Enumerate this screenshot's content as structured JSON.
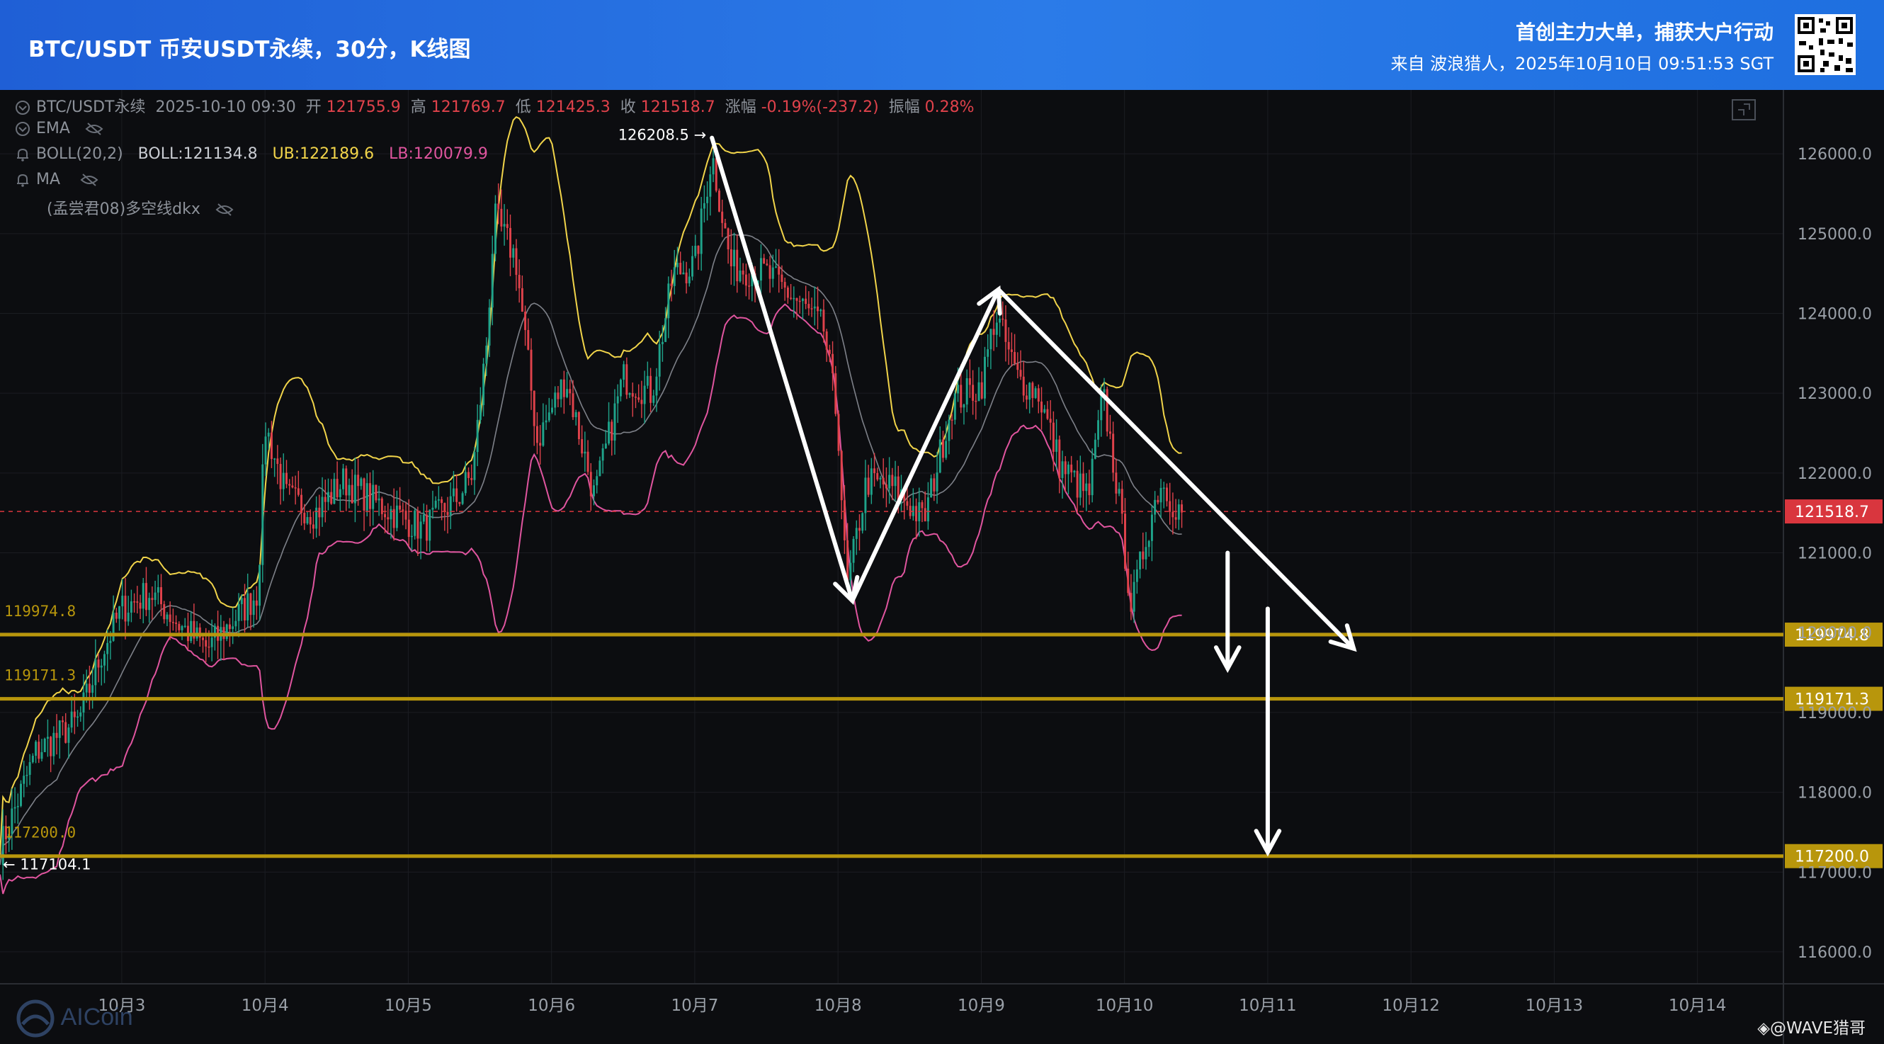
{
  "header": {
    "title": "BTC/USDT 币安USDT永续，30分，K线图",
    "tagline": "首创主力大单，捕获大户行动",
    "source": "来自 波浪猎人，2025年10月10日 09:51:53 SGT"
  },
  "legend": {
    "symbol": "BTC/USDT永续",
    "datetime": "2025-10-10 09:30",
    "open_label": "开",
    "open": "121755.9",
    "high_label": "高",
    "high": "121769.7",
    "low_label": "低",
    "low": "121425.3",
    "close_label": "收",
    "close": "121518.7",
    "change_label": "涨幅",
    "change": "-0.19%(-237.2)",
    "amplitude_label": "振幅",
    "amplitude": "0.28%",
    "ema": "EMA",
    "boll": "BOLL(20,2)",
    "boll_mid": "BOLL:121134.8",
    "boll_ub": "UB:122189.6",
    "boll_lb": "LB:120079.9",
    "ma": "MA",
    "custom": "(孟尝君08)多空线dkx"
  },
  "watermark": {
    "brand": "AICoin",
    "author": "◈@WAVE猎哥"
  },
  "colors": {
    "up": "#1fa38a",
    "down": "#e0424b",
    "ub": "#f1d44a",
    "lb": "#e0559f",
    "mid": "#9a9ea6",
    "level": "#b8960c",
    "price_tag": "#d9363e",
    "arrow": "#ffffff"
  },
  "chart_data": {
    "type": "candlestick",
    "interval": "30m",
    "ylim": [
      115600,
      126800
    ],
    "yticks": [
      116000,
      117000,
      118000,
      119000,
      120000,
      121000,
      122000,
      123000,
      124000,
      125000,
      126000
    ],
    "ytick_labels": [
      "116000.0",
      "117000.0",
      "118000.0",
      "119000.0",
      "120000.0",
      "121000.0",
      "122000.0",
      "123000.0",
      "124000.0",
      "125000.0",
      "126000.0"
    ],
    "x_day_labels": [
      "10月3",
      "10月4",
      "10月5",
      "10月6",
      "10月7",
      "10月8",
      "10月9",
      "10月10",
      "10月11",
      "10月12",
      "10月13",
      "10月14"
    ],
    "x_day_positions": [
      3,
      4,
      5,
      6,
      7,
      8,
      9,
      10,
      11,
      12,
      13,
      14
    ],
    "xlim": [
      2.15,
      14.6
    ],
    "current_price": 121518.7,
    "current_price_label": "121518.7",
    "max_annotation": {
      "x": 7.12,
      "y": 126208.5,
      "label": "126208.5 →"
    },
    "min_annotation": {
      "x": 2.15,
      "y": 117104.1,
      "label": "← 117104.1"
    },
    "levels": [
      {
        "value": 119974.8,
        "label": "119974.8"
      },
      {
        "value": 119171.3,
        "label": "119171.3"
      },
      {
        "value": 117200.0,
        "label": "117200.0"
      }
    ],
    "close_path": [
      [
        2.15,
        117300
      ],
      [
        2.4,
        118500
      ],
      [
        2.7,
        118900
      ],
      [
        2.85,
        119700
      ],
      [
        3.0,
        120300
      ],
      [
        3.2,
        120500
      ],
      [
        3.4,
        120100
      ],
      [
        3.6,
        119800
      ],
      [
        3.8,
        120200
      ],
      [
        3.95,
        120500
      ],
      [
        4.0,
        122600
      ],
      [
        4.15,
        121700
      ],
      [
        4.35,
        121500
      ],
      [
        4.55,
        121900
      ],
      [
        4.8,
        121600
      ],
      [
        5.1,
        121300
      ],
      [
        5.35,
        121700
      ],
      [
        5.45,
        122000
      ],
      [
        5.55,
        123700
      ],
      [
        5.6,
        125200
      ],
      [
        5.75,
        124700
      ],
      [
        5.9,
        122400
      ],
      [
        6.1,
        123200
      ],
      [
        6.3,
        121700
      ],
      [
        6.5,
        123200
      ],
      [
        6.7,
        123000
      ],
      [
        6.85,
        124500
      ],
      [
        7.0,
        124600
      ],
      [
        7.12,
        126000
      ],
      [
        7.25,
        124600
      ],
      [
        7.5,
        124500
      ],
      [
        7.75,
        124100
      ],
      [
        7.9,
        123800
      ],
      [
        8.0,
        122600
      ],
      [
        8.06,
        120500
      ],
      [
        8.2,
        121900
      ],
      [
        8.4,
        121800
      ],
      [
        8.6,
        121400
      ],
      [
        8.8,
        122900
      ],
      [
        9.0,
        123100
      ],
      [
        9.1,
        124000
      ],
      [
        9.25,
        123200
      ],
      [
        9.4,
        123000
      ],
      [
        9.55,
        122100
      ],
      [
        9.75,
        121700
      ],
      [
        9.85,
        123000
      ],
      [
        9.95,
        121800
      ],
      [
        10.05,
        120300
      ],
      [
        10.15,
        121200
      ],
      [
        10.25,
        121900
      ],
      [
        10.35,
        121600
      ],
      [
        10.4,
        121519
      ]
    ],
    "annotations": [
      {
        "type": "arrow-line",
        "from": [
          7.12,
          126200
        ],
        "to": [
          8.1,
          120400
        ]
      },
      {
        "type": "arrow-line",
        "from": [
          8.1,
          120400
        ],
        "to": [
          9.12,
          124300
        ]
      },
      {
        "type": "arrow-line",
        "from": [
          9.12,
          124300
        ],
        "to": [
          11.6,
          119800
        ]
      },
      {
        "type": "arrow-down",
        "from": [
          10.72,
          121000
        ],
        "to": [
          10.72,
          119550
        ]
      },
      {
        "type": "arrow-down",
        "from": [
          11.0,
          120300
        ],
        "to": [
          11.0,
          117250
        ]
      }
    ]
  }
}
